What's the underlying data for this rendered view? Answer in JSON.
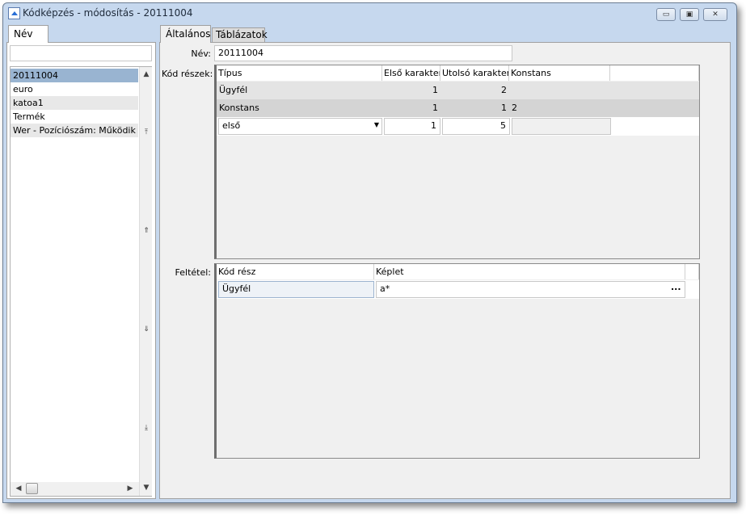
{
  "window": {
    "title": "Kódképzés - módosítás - 20111004",
    "minimize": "▭",
    "maximize": "▣",
    "close": "✕"
  },
  "left": {
    "tab": "Név",
    "search_value": "",
    "items": [
      "20111004",
      "euro",
      "katoa1",
      "Termék",
      "Wer - Pozíciószám: Működik e"
    ],
    "selected": 0
  },
  "right": {
    "tabs": [
      "Általános",
      "Táblázatok"
    ],
    "nev_label": "Név:",
    "nev_value": "20111004",
    "kod_label": "Kód részek:",
    "kod_columns": [
      "Típus",
      "Első karakter",
      "Utolsó karakter",
      "Konstans"
    ],
    "kod_rows": [
      [
        "Ügyfél",
        "1",
        "2",
        ""
      ],
      [
        "Konstans",
        "1",
        "1",
        "2"
      ]
    ],
    "kod_edit_row": {
      "tipus": "első",
      "elso": "1",
      "utolso": "5",
      "konstans": ""
    },
    "feltetel_label": "Feltétel:",
    "feltetel_columns": [
      "Kód rész",
      "Képlet"
    ],
    "feltetel_rows": [
      {
        "kod_resz": "Ügyfél",
        "keplet": "a*",
        "button": "..."
      }
    ]
  },
  "icons": {
    "up": "▲",
    "down": "▼",
    "left": "◀",
    "right": "▶",
    "dropdown": "▼",
    "scroll_top": "⤒",
    "page_up": "⇑",
    "page_down": "⇓",
    "scroll_bottom": "⤓"
  }
}
